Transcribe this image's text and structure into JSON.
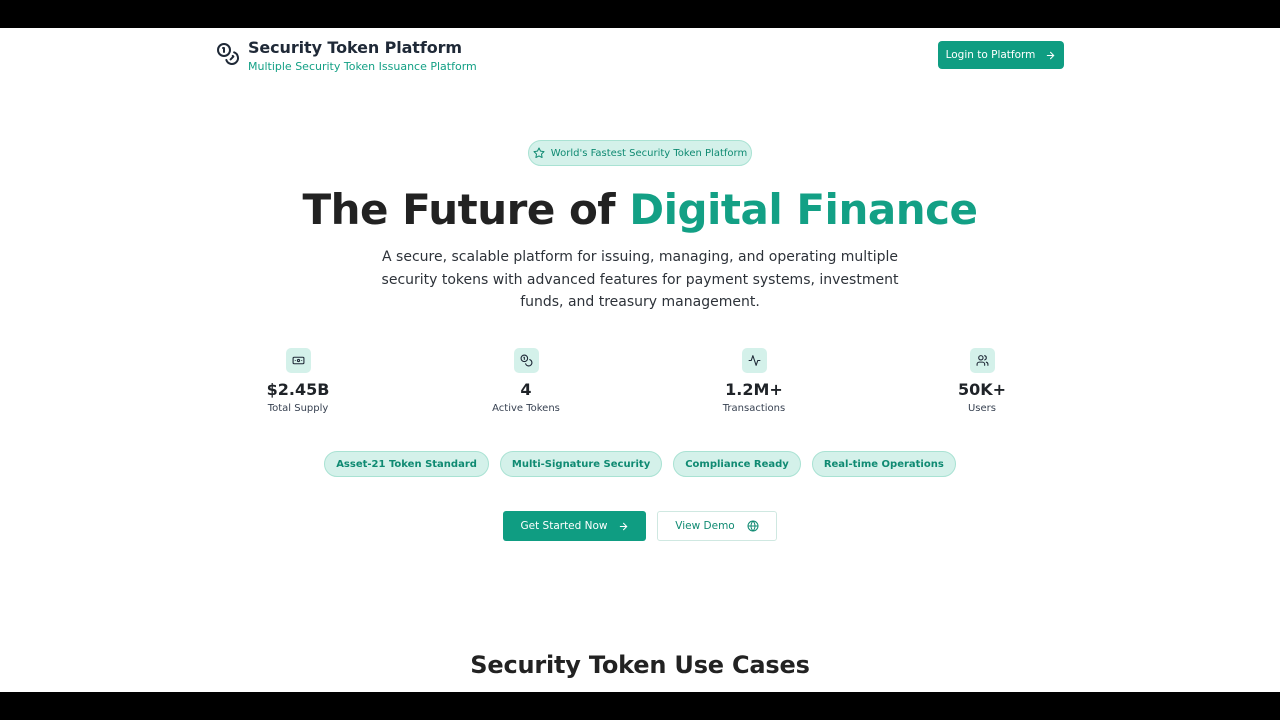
{
  "header": {
    "title": "Security Token Platform",
    "subtitle": "Multiple Security Token Issuance Platform",
    "login_label": "Login to Platform"
  },
  "badge": {
    "label": "World's Fastest Security Token Platform"
  },
  "hero": {
    "title_main": "The Future of ",
    "title_accent": "Digital Finance",
    "description": "A secure, scalable platform for issuing, managing, and operating multiple security tokens with advanced features for payment systems, investment funds, and treasury management."
  },
  "stats": [
    {
      "icon": "banknote-icon",
      "value": "$2.45B",
      "label": "Total Supply"
    },
    {
      "icon": "coins-icon",
      "value": "4",
      "label": "Active Tokens"
    },
    {
      "icon": "activity-icon",
      "value": "1.2M+",
      "label": "Transactions"
    },
    {
      "icon": "users-icon",
      "value": "50K+",
      "label": "Users"
    }
  ],
  "features": [
    "Asset-21 Token Standard",
    "Multi-Signature Security",
    "Compliance Ready",
    "Real-time Operations"
  ],
  "cta": {
    "primary_label": "Get Started Now",
    "secondary_label": "View Demo"
  },
  "section": {
    "title": "Security Token Use Cases"
  },
  "colors": {
    "accent": "#13a085",
    "button": "#0f9d82",
    "pill_bg": "#d4f1ea"
  }
}
